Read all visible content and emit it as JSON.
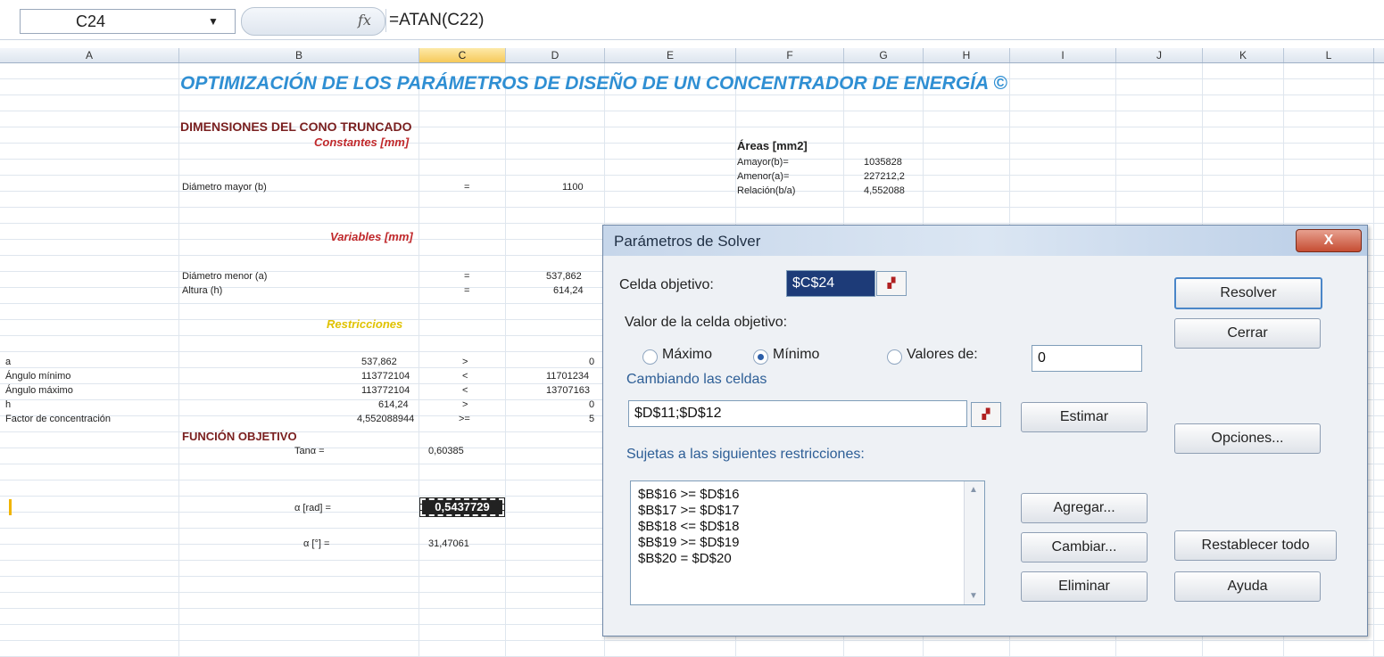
{
  "formula_bar": {
    "cell_ref": "C24",
    "fx_label": "fx",
    "formula": "=ATAN(C22)"
  },
  "columns": [
    "A",
    "B",
    "C",
    "D",
    "E",
    "F",
    "G",
    "H",
    "I",
    "J",
    "K",
    "L"
  ],
  "sheet": {
    "title": "OPTIMIZACIÓN DE LOS PARÁMETROS DE DISEÑO DE UN CONCENTRADOR DE ENERGÍA ©",
    "dimensions_heading": "DIMENSIONES DEL CONO TRUNCADO",
    "constantes_label": "Constantes [mm]",
    "diametro_mayor_label": "Diámetro mayor (b)",
    "diametro_mayor_op": "=",
    "diametro_mayor_value": "1100",
    "areas_heading": "Áreas [mm2]",
    "areas": [
      {
        "label": "Amayor(b)=",
        "value": "1035828"
      },
      {
        "label": "Amenor(a)=",
        "value": "227212,2"
      },
      {
        "label": "Relación(b/a)",
        "value": "4,552088"
      }
    ],
    "variables_label": "Variables [mm]",
    "diametro_menor_label": "Diámetro menor (a)",
    "diametro_menor_op": "=",
    "diametro_menor_value": "537,862",
    "altura_label": "Altura (h)",
    "altura_op": "=",
    "altura_value": "614,24",
    "restricciones_label": "Restricciones",
    "restricciones": [
      {
        "label": "a",
        "value": "537,862",
        "op": ">",
        "limit": "0"
      },
      {
        "label": "Ángulo mínimo",
        "value": "113772104",
        "op": "<",
        "limit": "11701234"
      },
      {
        "label": "Ángulo máximo",
        "value": "113772104",
        "op": "<",
        "limit": "13707163"
      },
      {
        "label": "h",
        "value": "614,24",
        "op": ">",
        "limit": "0"
      },
      {
        "label": "Factor de concentración",
        "value": "4,552088944",
        "op": ">=",
        "limit": "5"
      }
    ],
    "funcion_heading": "FUNCIÓN OBJETIVO",
    "tan_label": "Tanα =",
    "tan_value": "0,60385",
    "alpha_rad_label": "α [rad] =",
    "alpha_rad_value": "0,5437729",
    "alpha_deg_label": "α [°] =",
    "alpha_deg_value": "31,47061"
  },
  "solver": {
    "title": "Parámetros de Solver",
    "close": "X",
    "celda_objetivo_label": "Celda objetivo:",
    "celda_objetivo_value": "$C$24",
    "valor_label": "Valor de la celda objetivo:",
    "maximo": "Máximo",
    "minimo": "Mínimo",
    "valores_de": "Valores de:",
    "valores_de_value": "0",
    "cambiando_label": "Cambiando las celdas",
    "cambiando_value": "$D$11;$D$12",
    "sujetas_label": "Sujetas a las siguientes restricciones:",
    "constraints": [
      "$B$16 >= $D$16",
      "$B$17 >= $D$17",
      "$B$18 <= $D$18",
      "$B$19 >= $D$19",
      "$B$20 = $D$20"
    ],
    "buttons": {
      "resolver": "Resolver",
      "cerrar": "Cerrar",
      "estimar": "Estimar",
      "opciones": "Opciones...",
      "agregar": "Agregar...",
      "cambiar": "Cambiar...",
      "eliminar": "Eliminar",
      "restablecer": "Restablecer todo",
      "ayuda": "Ayuda"
    },
    "ref_icon": "collapse-dialog-icon"
  }
}
